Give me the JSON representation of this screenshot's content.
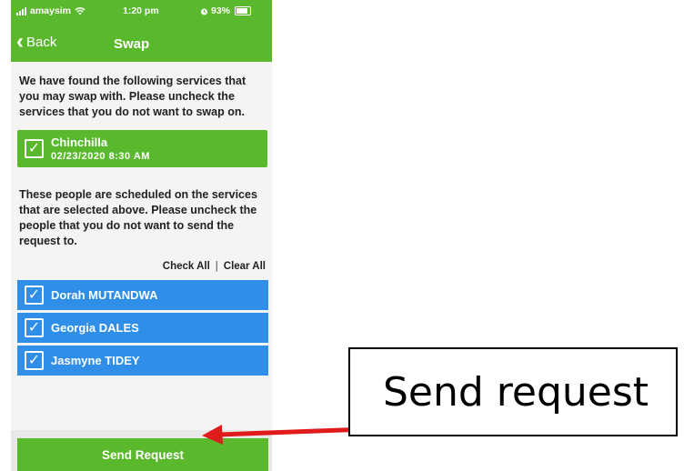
{
  "status_bar": {
    "carrier": "amaysim",
    "time": "1:20 pm",
    "battery": "93%",
    "icons": [
      "signal-icon",
      "wifi-icon",
      "alarm-icon",
      "battery-icon"
    ]
  },
  "nav": {
    "back_label": "Back",
    "title": "Swap"
  },
  "intro_text": "We have found the following services that you may swap with. Please uncheck the services that you do not want to swap on.",
  "service": {
    "name": "Chinchilla",
    "datetime": "02/23/2020 8:30 AM",
    "checked": true
  },
  "people_text": "These people are scheduled on the services that are selected above. Please uncheck the people that you do not want to send the request to.",
  "actions": {
    "check_all": "Check All",
    "separator": "|",
    "clear_all": "Clear All"
  },
  "people": [
    {
      "name": "Dorah MUTANDWA",
      "checked": true
    },
    {
      "name": "Georgia DALES",
      "checked": true
    },
    {
      "name": "Jasmyne TIDEY",
      "checked": true
    }
  ],
  "send_button_label": "Send Request",
  "callout": {
    "text": "Send request"
  },
  "colors": {
    "header_green": "#5ab82c",
    "person_blue": "#2e8ee8",
    "arrow_red": "#e01b1b"
  }
}
